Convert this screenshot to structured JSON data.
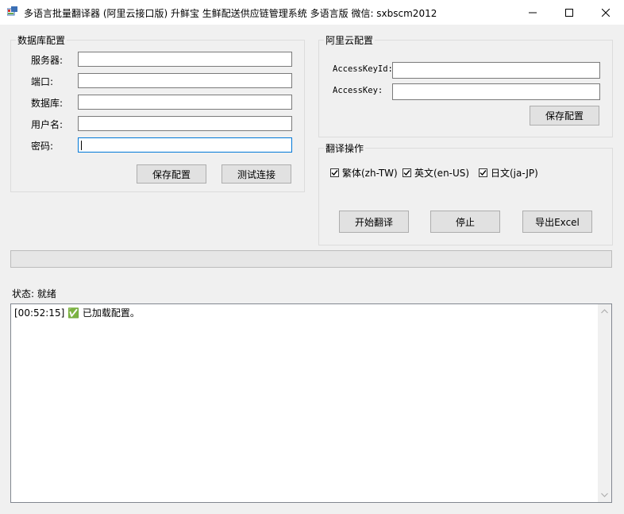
{
  "window": {
    "title": "多语言批量翻译器 (阿里云接口版) 升鲜宝 生鲜配送供应链管理系统 多语言版  微信: sxbscm2012"
  },
  "db_group": {
    "title": "数据库配置",
    "server_label": "服务器:",
    "port_label": "端口:",
    "database_label": "数据库:",
    "username_label": "用户名:",
    "password_label": "密码:",
    "server_value": "",
    "port_value": "",
    "database_value": "",
    "username_value": "",
    "password_value": "",
    "save_label": "保存配置",
    "test_label": "测试连接"
  },
  "aliyun_group": {
    "title": "阿里云配置",
    "key_id_label": "AccessKeyId:",
    "key_label": "AccessKey:",
    "key_id_value": "",
    "key_value": "",
    "save_label": "保存配置"
  },
  "translate_group": {
    "title": "翻译操作",
    "options": [
      {
        "label": "繁体(zh-TW)",
        "checked": true
      },
      {
        "label": "英文(en-US)",
        "checked": true
      },
      {
        "label": "日文(ja-JP)",
        "checked": true
      }
    ],
    "start_label": "开始翻译",
    "stop_label": "停止",
    "export_label": "导出Excel"
  },
  "progress": {
    "value": 0
  },
  "status": {
    "text": "状态: 就绪"
  },
  "log": {
    "line": "[00:52:15] ✅ 已加载配置。"
  },
  "colors": {
    "accent": "#0078d7"
  }
}
